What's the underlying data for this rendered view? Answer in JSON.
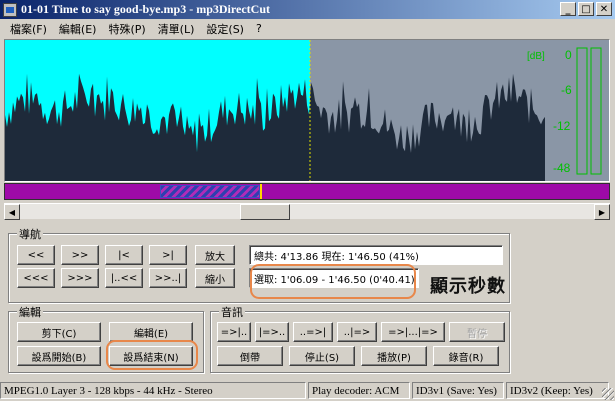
{
  "window": {
    "title": "01-01 Time to say good-bye.mp3 - mp3DirectCut"
  },
  "menu": [
    "檔案(F)",
    "編輯(E)",
    "特殊(P)",
    "清單(L)",
    "設定(S)",
    "?"
  ],
  "waveform": {
    "played_color": "#00ffff",
    "wave_color": "#1e2a3a",
    "rest_bg": "#8a96a6",
    "level_color": "#00c000",
    "cursor_fraction": 0.41,
    "meter": {
      "db_label": "[dB]",
      "ticks": [
        "0",
        "-6",
        "-12",
        "-48"
      ]
    }
  },
  "position_bar": {
    "color": "#9e0aa8",
    "selection_color": "#3a50c0",
    "cursor_color": "#ffd800"
  },
  "nav": {
    "title": "導航",
    "row1": [
      "<<",
      ">>",
      "|<",
      ">|"
    ],
    "row2": [
      "<<<",
      ">>>",
      "|..<<",
      ">>..|"
    ],
    "zoom_in": "放大",
    "zoom_out": "縮小",
    "info": "總共: 4'13.86   現在: 1'46.50   (41%)",
    "selection": "選取: 1'06.09 - 1'46.50 (0'40.41)"
  },
  "callout": "顯示秒數",
  "edit": {
    "title": "編輯",
    "cut": "剪下(C)",
    "edit": "編輯(E)",
    "set_start": "設爲開始(B)",
    "set_end": "設爲結束(N)"
  },
  "audio": {
    "title": "音訊",
    "row1": [
      "=>|..",
      "|=>..",
      "..=>|",
      "..|=>",
      "=>|...|=>",
      "暫停"
    ],
    "rewind": "倒帶",
    "stop": "停止(S)",
    "play": "播放(P)",
    "record": "錄音(R)"
  },
  "status": [
    "MPEG1.0 Layer 3 - 128 kbps - 44 kHz - Stereo",
    "Play decoder: ACM",
    "ID3v1 (Save: Yes)",
    "ID3v2 (Keep: Yes)"
  ],
  "accent": {
    "highlight_ring": "#e8874a"
  }
}
